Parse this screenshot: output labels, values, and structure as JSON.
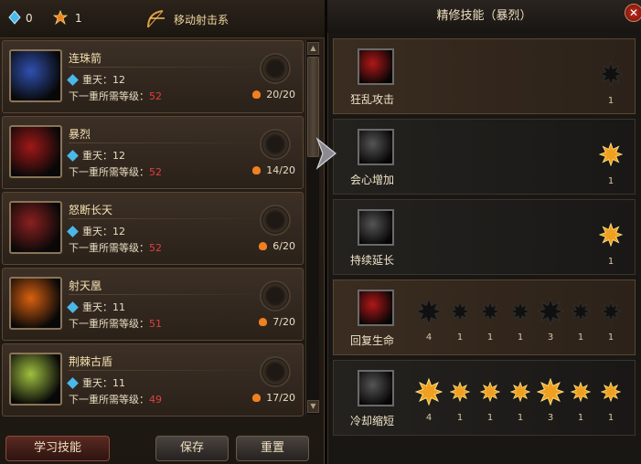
{
  "header": {
    "resource1": "0",
    "resource2": "1",
    "class_title": "移动射击系"
  },
  "skills": [
    {
      "name": "连珠箭",
      "level": "重天：12",
      "req_label": "下一重所需等级：",
      "req_value": "52",
      "progress": "20/20",
      "icon_color": "#3050b0"
    },
    {
      "name": "暴烈",
      "level": "重天：12",
      "req_label": "下一重所需等级：",
      "req_value": "52",
      "progress": "14/20",
      "icon_color": "#a01818"
    },
    {
      "name": "怒断长天",
      "level": "重天：12",
      "req_label": "下一重所需等级：",
      "req_value": "52",
      "progress": "6/20",
      "icon_color": "#8a2020"
    },
    {
      "name": "射天凰",
      "level": "重天：11",
      "req_label": "下一重所需等级：",
      "req_value": "51",
      "progress": "7/20",
      "icon_color": "#d86010"
    },
    {
      "name": "荆棘古盾",
      "level": "重天：11",
      "req_label": "下一重所需等级：",
      "req_value": "49",
      "progress": "17/20",
      "icon_color": "#a0c040"
    }
  ],
  "buttons": {
    "learn": "学习技能",
    "save": "保存",
    "reset": "重置",
    "scroll_up": "▲",
    "scroll_down": "▼",
    "close": "✕"
  },
  "right": {
    "title": "精修技能（暴烈）",
    "rows": [
      {
        "name": "狂乱攻击",
        "style": "brown",
        "icon_color": "#b01818",
        "stars": [
          {
            "value": "1",
            "lit": false
          }
        ]
      },
      {
        "name": "会心增加",
        "style": "gray",
        "icon_color": "#555555",
        "stars": [
          {
            "value": "1",
            "lit": true
          }
        ]
      },
      {
        "name": "持续延长",
        "style": "gray",
        "icon_color": "#555555",
        "stars": [
          {
            "value": "1",
            "lit": true
          }
        ]
      },
      {
        "name": "回复生命",
        "style": "brown",
        "icon_color": "#b01818",
        "stars": [
          {
            "value": "4",
            "lit": false
          },
          {
            "value": "1",
            "lit": false
          },
          {
            "value": "1",
            "lit": false
          },
          {
            "value": "1",
            "lit": false
          },
          {
            "value": "3",
            "lit": false
          },
          {
            "value": "1",
            "lit": false
          },
          {
            "value": "1",
            "lit": false
          }
        ]
      },
      {
        "name": "冷却缩短",
        "style": "gray",
        "icon_color": "#555555",
        "stars": [
          {
            "value": "4",
            "lit": true
          },
          {
            "value": "1",
            "lit": true
          },
          {
            "value": "1",
            "lit": true
          },
          {
            "value": "1",
            "lit": true
          },
          {
            "value": "3",
            "lit": true
          },
          {
            "value": "1",
            "lit": true
          },
          {
            "value": "1",
            "lit": true
          }
        ]
      }
    ]
  }
}
